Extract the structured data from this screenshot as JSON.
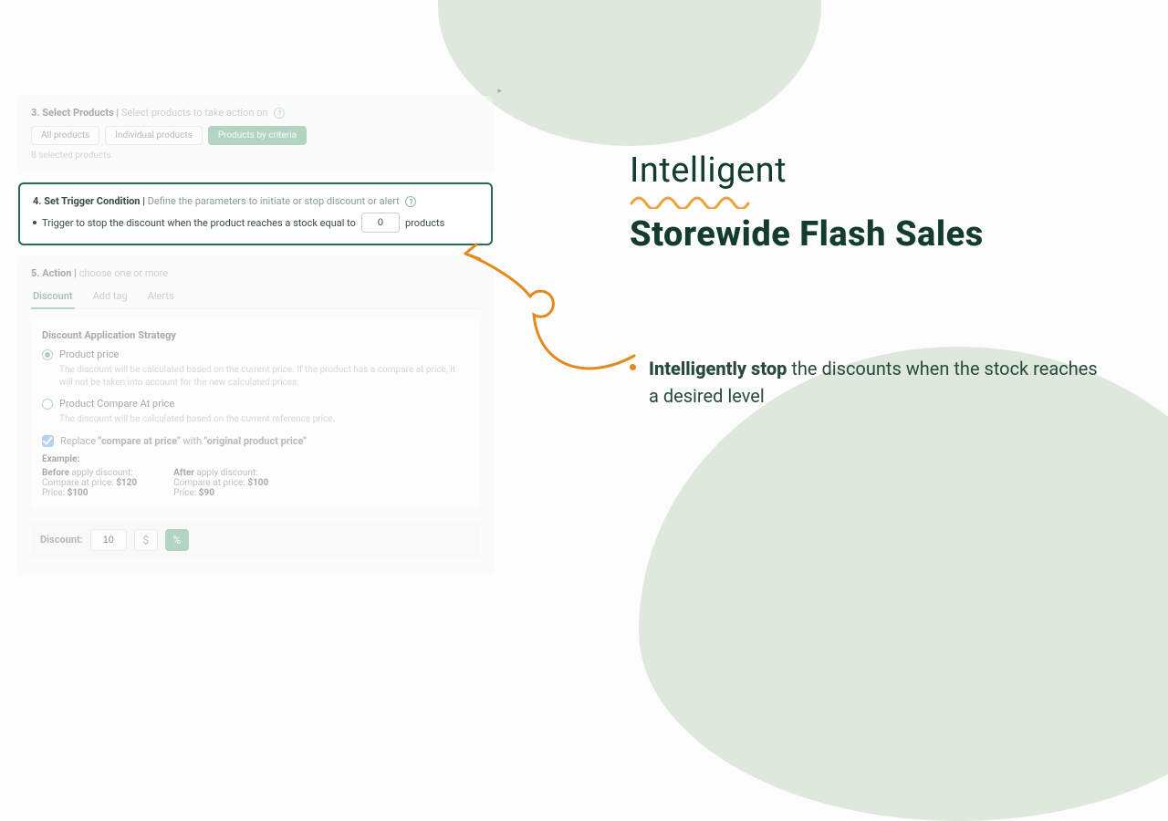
{
  "marketing": {
    "title_line1": "Intelligent",
    "title_line2": "Storewide Flash Sales",
    "bullet_bold": "Intelligently stop",
    "bullet_rest": " the discounts when the stock reaches a desired level"
  },
  "select_products": {
    "number": "3.",
    "title": "Select Products",
    "sub": "Select products to take action on",
    "pills": {
      "all": "All products",
      "individual": "Individual products",
      "criteria": "Products by criteria"
    },
    "selected_note": "8 selected products"
  },
  "trigger": {
    "number": "4.",
    "title": "Set Trigger Condition",
    "sub": "Define the parameters to initiate or stop discount or alert",
    "line_a": "Trigger to stop the discount when the product reaches a stock equal to",
    "value": "0",
    "line_b": "products"
  },
  "action": {
    "number": "5.",
    "title": "Action",
    "sub": "choose one or more",
    "tabs": {
      "discount": "Discount",
      "addtag": "Add tag",
      "alerts": "Alerts"
    },
    "strategy_title": "Discount Application Strategy",
    "opt1_label": "Product price",
    "opt1_desc": "The discount will be calculated based on the current price. If the product has a compare at price, it will not be taken into account for the new calculated prices.",
    "opt2_label": "Product Compare At price",
    "opt2_desc": "The discount will be calculated based on the current reference price.",
    "replace_a": "Replace ",
    "replace_b": "\"compare at price\"",
    "replace_c": " with ",
    "replace_d": "\"original product price\"",
    "example_label": "Example:",
    "before_label": "Before",
    "after_label": "After",
    "apply_suffix": " apply discount:",
    "cap_label": "Compare at price: ",
    "price_label": "Price: ",
    "before_cap": "$120",
    "before_price": "$100",
    "after_cap": "$100",
    "after_price": "$90",
    "discount_label": "Discount:",
    "discount_value": "10",
    "currency": "$",
    "percent": "%"
  }
}
